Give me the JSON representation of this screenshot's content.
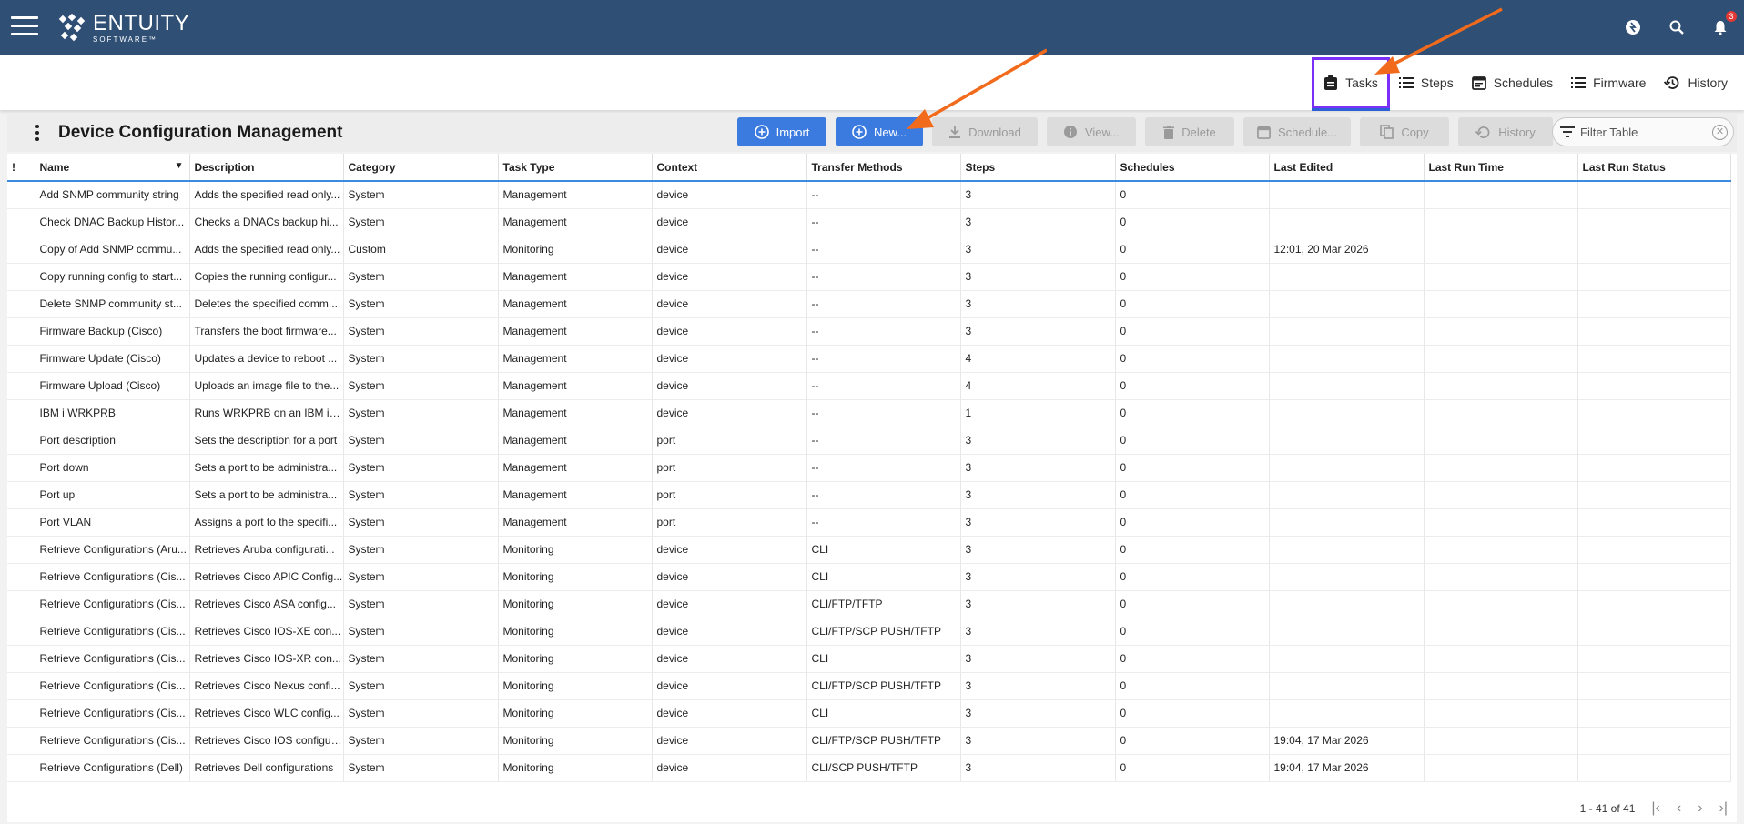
{
  "app": {
    "logo_main": "ENTUITY",
    "logo_sub": "SOFTWARE™",
    "notification_count": "3"
  },
  "subnav": {
    "tabs": [
      {
        "label": "Tasks",
        "icon": "clipboard-icon",
        "active": true
      },
      {
        "label": "Steps",
        "icon": "list-icon",
        "active": false
      },
      {
        "label": "Schedules",
        "icon": "calendar-icon",
        "active": false
      },
      {
        "label": "Firmware",
        "icon": "list-icon",
        "active": false
      },
      {
        "label": "History",
        "icon": "history-icon",
        "active": false
      }
    ]
  },
  "toolbar": {
    "title": "Device Configuration Management",
    "import_label": "Import",
    "new_label": "New...",
    "download_label": "Download",
    "view_label": "View...",
    "delete_label": "Delete",
    "schedule_label": "Schedule...",
    "copy_label": "Copy",
    "history_label": "History",
    "filter_placeholder": "Filter Table"
  },
  "table": {
    "columns": [
      "!",
      "Name",
      "Description",
      "Category",
      "Task Type",
      "Context",
      "Transfer Methods",
      "Steps",
      "Schedules",
      "Last Edited",
      "Last Run Time",
      "Last Run Status"
    ],
    "rows": [
      [
        "",
        "Add SNMP community string",
        "Adds the specified read only...",
        "System",
        "Management",
        "device",
        "--",
        "3",
        "0",
        "",
        "",
        ""
      ],
      [
        "",
        "Check DNAC Backup Histor...",
        "Checks a DNACs backup hi...",
        "System",
        "Management",
        "device",
        "--",
        "3",
        "0",
        "",
        "",
        ""
      ],
      [
        "",
        "Copy of Add SNMP commu...",
        "Adds the specified read only...",
        "Custom",
        "Monitoring",
        "device",
        "--",
        "3",
        "0",
        "12:01, 20 Mar 2026",
        "",
        ""
      ],
      [
        "",
        "Copy running config to start...",
        "Copies the running configur...",
        "System",
        "Management",
        "device",
        "--",
        "3",
        "0",
        "",
        "",
        ""
      ],
      [
        "",
        "Delete SNMP community st...",
        "Deletes the specified comm...",
        "System",
        "Management",
        "device",
        "--",
        "3",
        "0",
        "",
        "",
        ""
      ],
      [
        "",
        "Firmware Backup (Cisco)",
        "Transfers the boot firmware...",
        "System",
        "Management",
        "device",
        "--",
        "3",
        "0",
        "",
        "",
        ""
      ],
      [
        "",
        "Firmware Update (Cisco)",
        "Updates a device to reboot ...",
        "System",
        "Management",
        "device",
        "--",
        "4",
        "0",
        "",
        "",
        ""
      ],
      [
        "",
        "Firmware Upload (Cisco)",
        "Uploads an image file to the...",
        "System",
        "Management",
        "device",
        "--",
        "4",
        "0",
        "",
        "",
        ""
      ],
      [
        "",
        "IBM i WRKPRB",
        "Runs WRKPRB on an IBM i d...",
        "System",
        "Management",
        "device",
        "--",
        "1",
        "0",
        "",
        "",
        ""
      ],
      [
        "",
        "Port description",
        "Sets the description for a port",
        "System",
        "Management",
        "port",
        "--",
        "3",
        "0",
        "",
        "",
        ""
      ],
      [
        "",
        "Port down",
        "Sets a port to be administra...",
        "System",
        "Management",
        "port",
        "--",
        "3",
        "0",
        "",
        "",
        ""
      ],
      [
        "",
        "Port up",
        "Sets a port to be administra...",
        "System",
        "Management",
        "port",
        "--",
        "3",
        "0",
        "",
        "",
        ""
      ],
      [
        "",
        "Port VLAN",
        "Assigns a port to the specifi...",
        "System",
        "Management",
        "port",
        "--",
        "3",
        "0",
        "",
        "",
        ""
      ],
      [
        "",
        "Retrieve Configurations (Aru...",
        "Retrieves Aruba configurati...",
        "System",
        "Monitoring",
        "device",
        "CLI",
        "3",
        "0",
        "",
        "",
        ""
      ],
      [
        "",
        "Retrieve Configurations (Cis...",
        "Retrieves Cisco APIC Config...",
        "System",
        "Monitoring",
        "device",
        "CLI",
        "3",
        "0",
        "",
        "",
        ""
      ],
      [
        "",
        "Retrieve Configurations (Cis...",
        "Retrieves Cisco ASA config...",
        "System",
        "Monitoring",
        "device",
        "CLI/FTP/TFTP",
        "3",
        "0",
        "",
        "",
        ""
      ],
      [
        "",
        "Retrieve Configurations (Cis...",
        "Retrieves Cisco IOS-XE con...",
        "System",
        "Monitoring",
        "device",
        "CLI/FTP/SCP PUSH/TFTP",
        "3",
        "0",
        "",
        "",
        ""
      ],
      [
        "",
        "Retrieve Configurations (Cis...",
        "Retrieves Cisco IOS-XR con...",
        "System",
        "Monitoring",
        "device",
        "CLI",
        "3",
        "0",
        "",
        "",
        ""
      ],
      [
        "",
        "Retrieve Configurations (Cis...",
        "Retrieves Cisco Nexus confi...",
        "System",
        "Monitoring",
        "device",
        "CLI/FTP/SCP PUSH/TFTP",
        "3",
        "0",
        "",
        "",
        ""
      ],
      [
        "",
        "Retrieve Configurations (Cis...",
        "Retrieves Cisco WLC config...",
        "System",
        "Monitoring",
        "device",
        "CLI",
        "3",
        "0",
        "",
        "",
        ""
      ],
      [
        "",
        "Retrieve Configurations (Cis...",
        "Retrieves Cisco IOS configur...",
        "System",
        "Monitoring",
        "device",
        "CLI/FTP/SCP PUSH/TFTP",
        "3",
        "0",
        "19:04, 17 Mar 2026",
        "",
        ""
      ],
      [
        "",
        "Retrieve Configurations (Dell)",
        "Retrieves Dell configurations",
        "System",
        "Monitoring",
        "device",
        "CLI/SCP PUSH/TFTP",
        "3",
        "0",
        "19:04, 17 Mar 2026",
        "",
        ""
      ]
    ]
  },
  "pager": {
    "range": "1 - 41 of 41"
  },
  "colors": {
    "topbar": "#2f4f75",
    "primary_button": "#3b7be0",
    "active_tab_border": "#7b2ff7",
    "annotation_arrow": "#f26a1b"
  }
}
